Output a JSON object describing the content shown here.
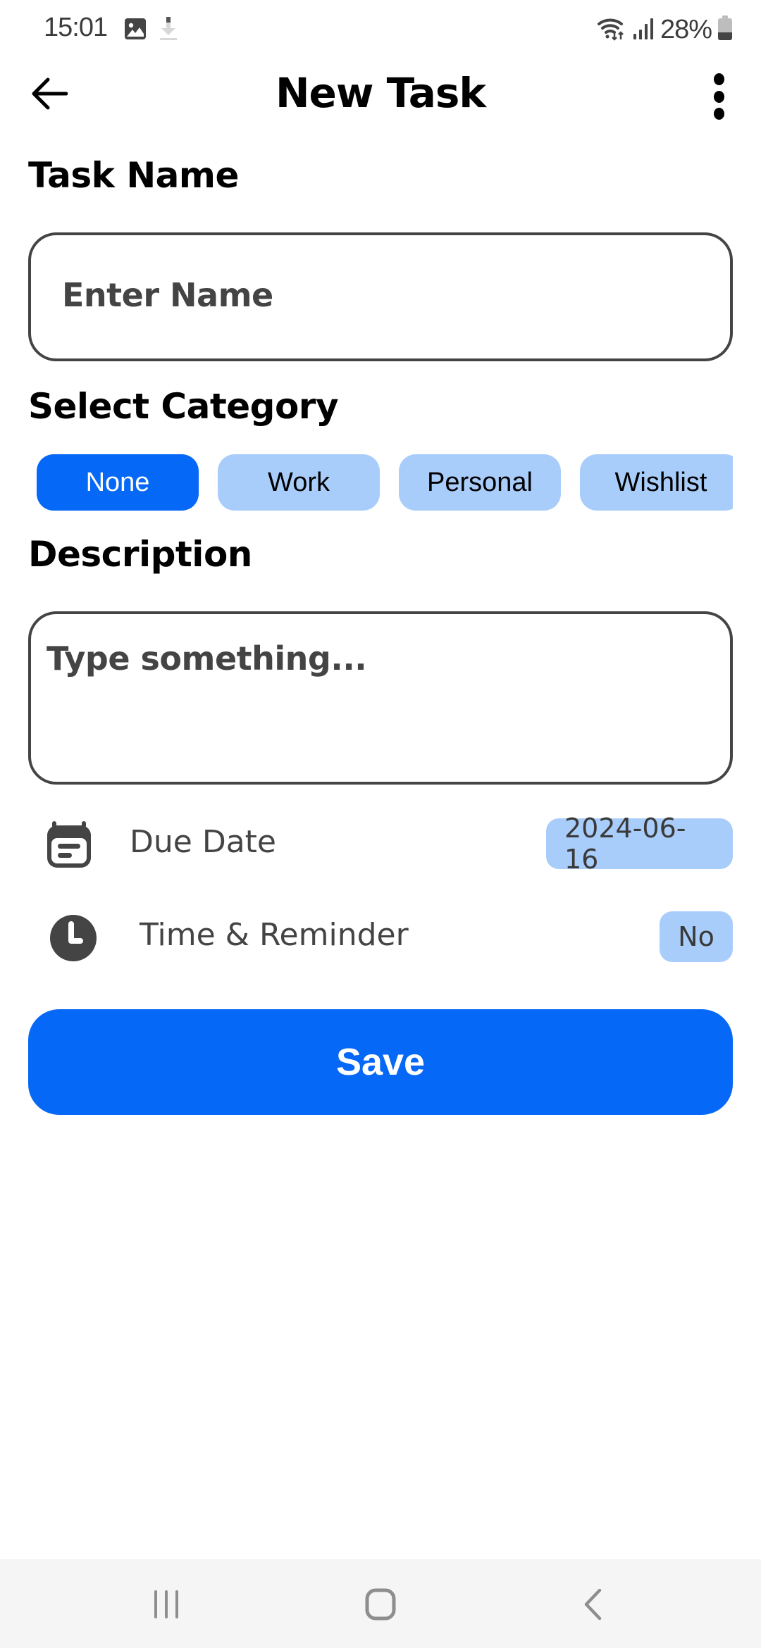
{
  "status_bar": {
    "time": "15:01",
    "battery_percent": "28%",
    "left_icons": [
      "gallery-notification-icon",
      "download-notification-icon"
    ],
    "right_icons": [
      "wifi-icon",
      "signal-icon",
      "battery-icon"
    ]
  },
  "app_bar": {
    "title": "New Task",
    "back_icon": "arrow-left-icon",
    "menu_icon": "more-vert-icon"
  },
  "task_name": {
    "label": "Task Name",
    "value": "",
    "placeholder": "Enter Name"
  },
  "category": {
    "label": "Select Category",
    "selected": "None",
    "chips": [
      {
        "label": "None",
        "selected": true
      },
      {
        "label": "Work",
        "selected": false
      },
      {
        "label": "Personal",
        "selected": false
      },
      {
        "label": "Wishlist",
        "selected": false
      }
    ]
  },
  "description": {
    "label": "Description",
    "value": "",
    "placeholder": "Type something..."
  },
  "options": {
    "due_date": {
      "label": "Due Date",
      "value": "2024-06-16",
      "icon": "calendar-icon"
    },
    "reminder": {
      "label": "Time & Reminder",
      "value": "No",
      "icon": "clock-icon"
    }
  },
  "save_label": "Save",
  "colors": {
    "primary": "#0568f6",
    "chip_unselected": "#a9cdfb",
    "border": "#444444",
    "nav_bar_bg": "#f5f5f5"
  },
  "nav_bar": {
    "recents_icon": "recents-icon",
    "home_icon": "home-icon",
    "back_icon": "nav-back-icon"
  }
}
